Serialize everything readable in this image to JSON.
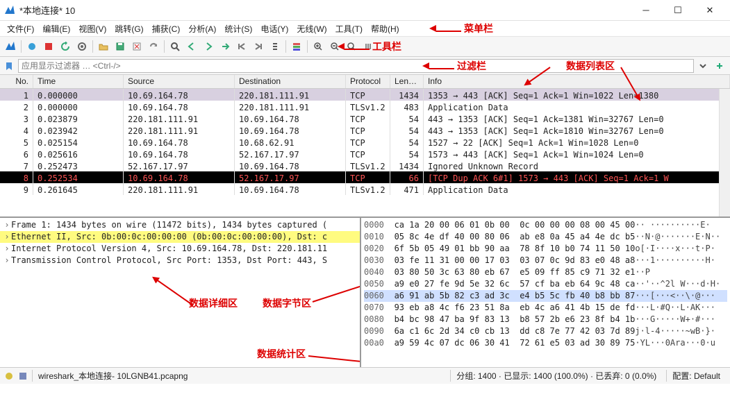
{
  "title": "*本地连接* 10",
  "annotations": {
    "menubar": "菜单栏",
    "toolbar": "工具栏",
    "filterbar": "过滤栏",
    "packetlist": "数据列表区",
    "details": "数据详细区",
    "bytes": "数据字节区",
    "stats": "数据统计区"
  },
  "menu": [
    {
      "id": "file",
      "label": "文件(F)"
    },
    {
      "id": "edit",
      "label": "编辑(E)"
    },
    {
      "id": "view",
      "label": "视图(V)"
    },
    {
      "id": "go",
      "label": "跳转(G)"
    },
    {
      "id": "capture",
      "label": "捕获(C)"
    },
    {
      "id": "analyze",
      "label": "分析(A)"
    },
    {
      "id": "statistics",
      "label": "统计(S)"
    },
    {
      "id": "telephony",
      "label": "电话(Y)"
    },
    {
      "id": "wireless",
      "label": "无线(W)"
    },
    {
      "id": "tools",
      "label": "工具(T)"
    },
    {
      "id": "help",
      "label": "帮助(H)"
    }
  ],
  "filter": {
    "placeholder": "应用显示过滤器 … <Ctrl-/>"
  },
  "columns": {
    "no": "No.",
    "time": "Time",
    "src": "Source",
    "dst": "Destination",
    "proto": "Protocol",
    "len": "Length",
    "info": "Info"
  },
  "packets": [
    {
      "no": 1,
      "time": "0.000000",
      "src": "10.69.164.78",
      "dst": "220.181.111.91",
      "proto": "TCP",
      "len": 1434,
      "info": "1353 → 443 [ACK] Seq=1 Ack=1 Win=1022 Len=1380",
      "sel": true
    },
    {
      "no": 2,
      "time": "0.000000",
      "src": "10.69.164.78",
      "dst": "220.181.111.91",
      "proto": "TLSv1.2",
      "len": 483,
      "info": "Application Data"
    },
    {
      "no": 3,
      "time": "0.023879",
      "src": "220.181.111.91",
      "dst": "10.69.164.78",
      "proto": "TCP",
      "len": 54,
      "info": "443 → 1353 [ACK] Seq=1 Ack=1381 Win=32767 Len=0"
    },
    {
      "no": 4,
      "time": "0.023942",
      "src": "220.181.111.91",
      "dst": "10.69.164.78",
      "proto": "TCP",
      "len": 54,
      "info": "443 → 1353 [ACK] Seq=1 Ack=1810 Win=32767 Len=0"
    },
    {
      "no": 5,
      "time": "0.025154",
      "src": "10.69.164.78",
      "dst": "10.68.62.91",
      "proto": "TCP",
      "len": 54,
      "info": "1527 → 22 [ACK] Seq=1 Ack=1 Win=1028 Len=0"
    },
    {
      "no": 6,
      "time": "0.025616",
      "src": "10.69.164.78",
      "dst": "52.167.17.97",
      "proto": "TCP",
      "len": 54,
      "info": "1573 → 443 [ACK] Seq=1 Ack=1 Win=1024 Len=0"
    },
    {
      "no": 7,
      "time": "0.252473",
      "src": "52.167.17.97",
      "dst": "10.69.164.78",
      "proto": "TLSv1.2",
      "len": 1434,
      "info": "Ignored Unknown Record"
    },
    {
      "no": 8,
      "time": "0.252534",
      "src": "10.69.164.78",
      "dst": "52.167.17.97",
      "proto": "TCP",
      "len": 66,
      "info": "[TCP Dup ACK 6#1] 1573 → 443 [ACK] Seq=1 Ack=1 W",
      "dup": true
    },
    {
      "no": 9,
      "time": "0.261645",
      "src": "220.181.111.91",
      "dst": "10.69.164.78",
      "proto": "TLSv1.2",
      "len": 471,
      "info": "Application Data"
    }
  ],
  "details": [
    {
      "text": "Frame 1: 1434 bytes on wire (11472 bits), 1434 bytes captured ("
    },
    {
      "text": "Ethernet II, Src: 0b:00:0c:00:00:00 (0b:00:0c:00:00:00), Dst: c",
      "hl": true
    },
    {
      "text": "Internet Protocol Version 4, Src: 10.69.164.78, Dst: 220.181.11"
    },
    {
      "text": "Transmission Control Protocol, Src Port: 1353, Dst Port: 443, S"
    }
  ],
  "hex": [
    {
      "off": "0000",
      "b": "ca 1a 20 00 06 01 0b 00  0c 00 00 00 08 00 45 00",
      "a": "·· ··········E·"
    },
    {
      "off": "0010",
      "b": "05 8c 4e df 40 00 80 06  ab e8 0a 45 a4 4e dc b5",
      "a": "··N·@·······E·N··"
    },
    {
      "off": "0020",
      "b": "6f 5b 05 49 01 bb 90 aa  78 8f 10 b0 74 11 50 10",
      "a": "o[·I····x···t·P·"
    },
    {
      "off": "0030",
      "b": "03 fe 11 31 00 00 17 03  03 07 0c 9d 83 e0 48 a8",
      "a": "···1··········H·"
    },
    {
      "off": "0040",
      "b": "03 80 50 3c 63 80 eb 67  e5 09 ff 85 c9 71 32 e1",
      "a": "··P<c··g·····q2·"
    },
    {
      "off": "0050",
      "b": "a9 e0 27 fe 9d 5e 32 6c  57 cf ba eb 64 9c 48 ca",
      "a": "··'··^2l W···d·H·"
    },
    {
      "off": "0060",
      "b": "a6 91 ab 5b 82 c3 ad 3c  e4 b5 5c fb 40 b8 bb 87",
      "a": "···[···<··\\·@···",
      "hl": true
    },
    {
      "off": "0070",
      "b": "93 eb a8 4c f6 23 51 8a  eb 4c a6 41 4b 15 de fd",
      "a": "···L·#Q··L·AK···"
    },
    {
      "off": "0080",
      "b": "b4 bc 98 47 ba 9f 83 13  b8 57 2b e6 23 8f b4 1b",
      "a": "···G·····W+·#···"
    },
    {
      "off": "0090",
      "b": "6a c1 6c 2d 34 c0 cb 13  dd c8 7e 77 42 03 7d 89",
      "a": "j·l-4·····~wB·}·"
    },
    {
      "off": "00a0",
      "b": "a9 59 4c 07 dc 06 30 41  72 61 e5 03 ad 30 89 75",
      "a": "·YL···0Ara···0·u"
    }
  ],
  "status": {
    "file": "wireshark_本地连接- 10LGNB41.pcapng",
    "packets": "分组: 1400 · 已显示: 1400 (100.0%) · 已丢弃: 0 (0.0%)",
    "profile": "配置: Default"
  }
}
